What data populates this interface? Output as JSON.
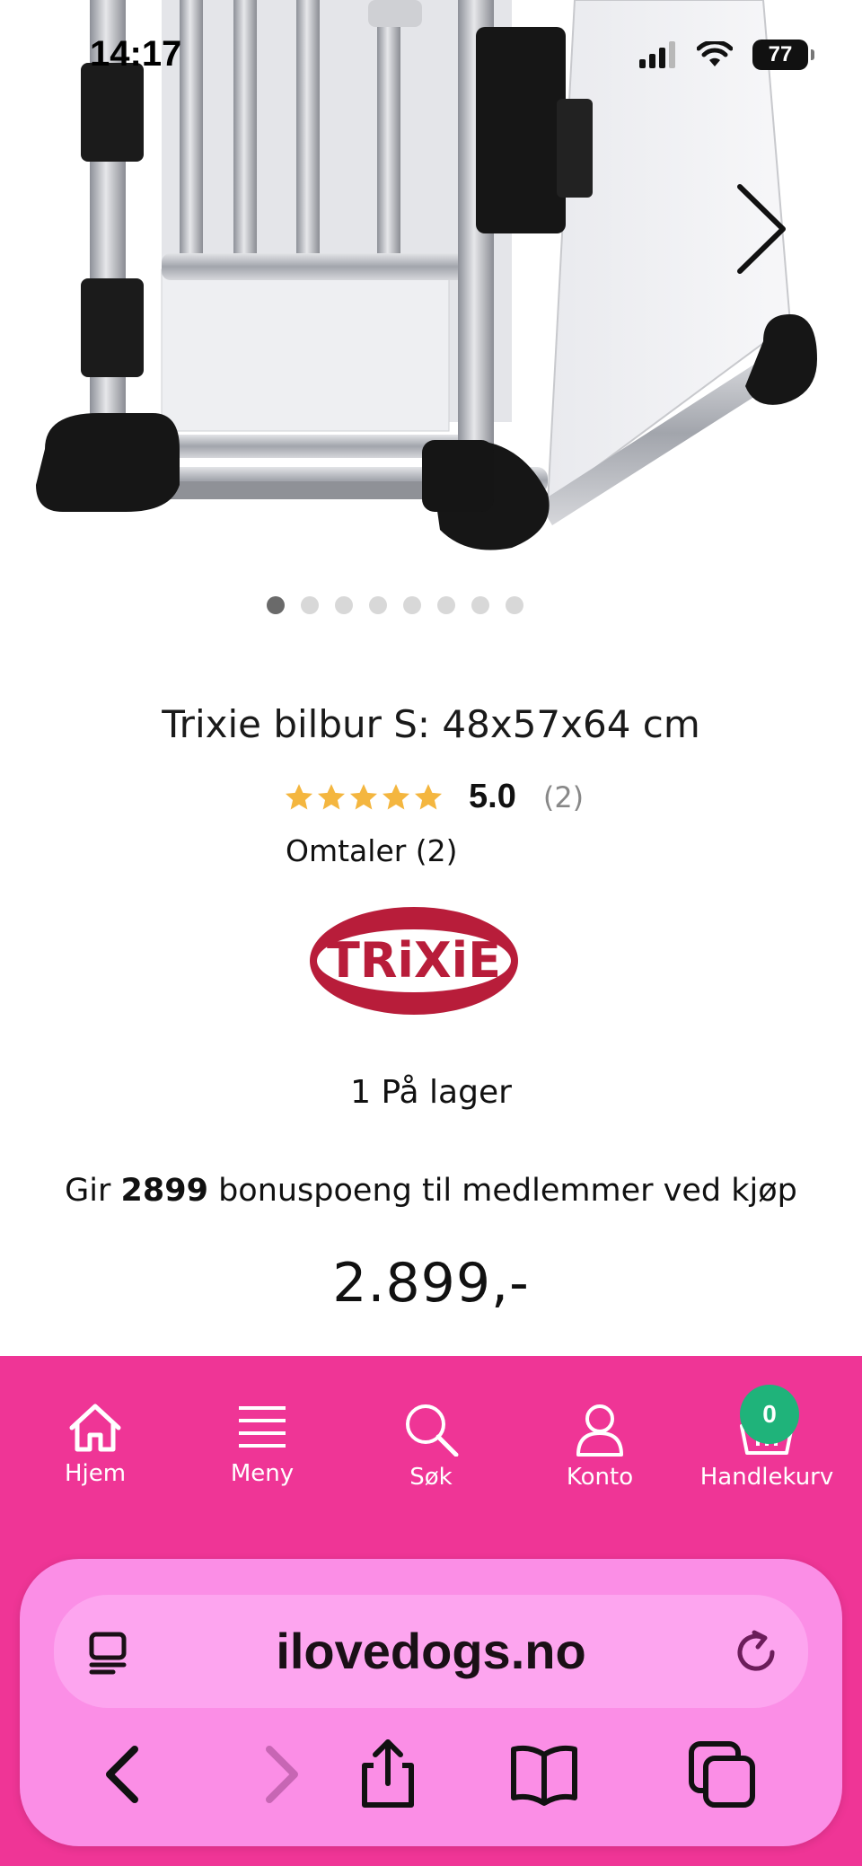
{
  "status_bar": {
    "time": "14:17",
    "battery": "77"
  },
  "carousel": {
    "dot_count": 8,
    "active_index": 0
  },
  "product": {
    "title": "Trixie bilbur S: 48x57x64 cm",
    "rating": {
      "score": "5.0",
      "count": "(2)",
      "stars": 5
    },
    "reviews_link": "Omtaler (2)",
    "brand_logo_text": "TRiXiE",
    "stock": "1 På lager",
    "bonus": {
      "prefix": "Gir ",
      "points": "2899",
      "suffix": " bonuspoeng til medlemmer ved kjøp"
    },
    "price": "2.899,-"
  },
  "bottom_nav": {
    "items": [
      {
        "label": "Hjem",
        "icon": "home-icon"
      },
      {
        "label": "Meny",
        "icon": "menu-icon"
      },
      {
        "label": "Søk",
        "icon": "search-icon"
      },
      {
        "label": "Konto",
        "icon": "account-icon"
      },
      {
        "label": "Handlekurv",
        "icon": "basket-icon"
      }
    ],
    "cart_count": "0"
  },
  "browser": {
    "url": "ilovedogs.no"
  },
  "colors": {
    "nav_bg": "#ef3596",
    "browser_bar_bg": "#fb8ee6",
    "badge_green": "#1fb37a",
    "star_gold": "#f4b63f",
    "brand_red": "#b81d3a"
  }
}
